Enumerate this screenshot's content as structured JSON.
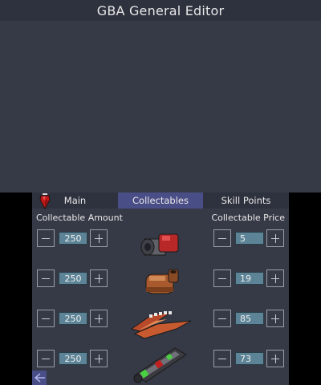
{
  "window": {
    "title": "GBA General Editor"
  },
  "tabs": [
    {
      "label": "Main",
      "icon": "red-gem-icon"
    },
    {
      "label": "Collectables"
    },
    {
      "label": "Skill Points"
    }
  ],
  "headers": {
    "amount": "Collectable Amount",
    "price": "Collectable Price"
  },
  "items": [
    {
      "icon": "red-canister-icon",
      "amount": "250",
      "price": "5"
    },
    {
      "icon": "brown-tube-icon",
      "amount": "250",
      "price": "19"
    },
    {
      "icon": "claw-icon",
      "amount": "250",
      "price": "85"
    },
    {
      "icon": "green-wand-icon",
      "amount": "250",
      "price": "73"
    }
  ],
  "colors": {
    "background": "#363a46",
    "active_tab": "#4a4e86",
    "value_box": "#5d8496"
  }
}
